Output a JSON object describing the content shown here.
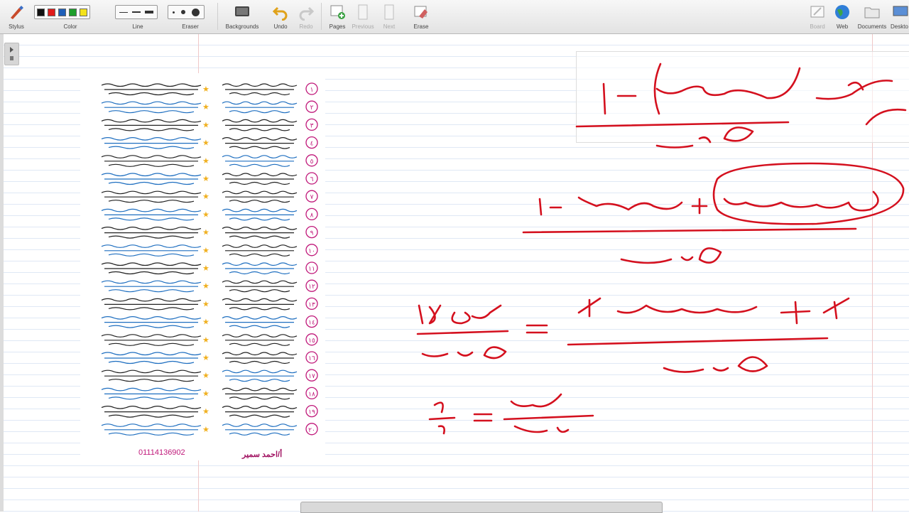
{
  "toolbar": {
    "stylus": "Stylus",
    "color": "Color",
    "line": "Line",
    "eraser": "Eraser",
    "backgrounds": "Backgrounds",
    "undo": "Undo",
    "redo": "Redo",
    "pages": "Pages",
    "previous": "Previous",
    "next": "Next",
    "erase": "Erase",
    "board": "Board",
    "web": "Web",
    "documents": "Documents",
    "desktop": "Deskto",
    "colors": [
      "#111111",
      "#e01b1b",
      "#1f5fb8",
      "#1e9e2c",
      "#f4e21a"
    ]
  },
  "worksheet": {
    "numbers": [
      "١",
      "٢",
      "٣",
      "٤",
      "٥",
      "٦",
      "٧",
      "٨",
      "٩",
      "١٠",
      "١١",
      "١٢",
      "١٣",
      "١٤",
      "١٥",
      "١٦",
      "١٧",
      "١٨",
      "١٩",
      "٢٠"
    ],
    "phone": "01114136902",
    "author": "أ/احمد سمير"
  }
}
